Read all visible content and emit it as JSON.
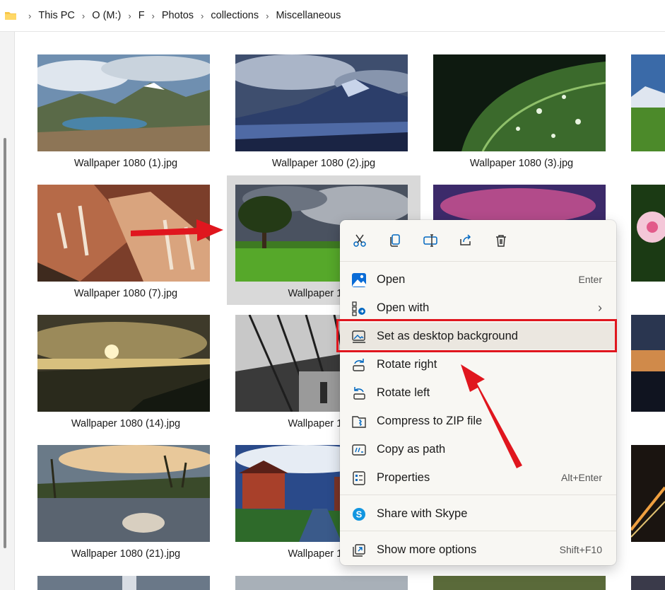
{
  "breadcrumb": {
    "items": [
      "This PC",
      "O (M:)",
      "F",
      "Photos",
      "collections",
      "Miscellaneous"
    ]
  },
  "files": [
    {
      "name": "Wallpaper 1080 (1).jpg",
      "scene": "mountain-lake"
    },
    {
      "name": "Wallpaper 1080 (2).jpg",
      "scene": "snow-mountain"
    },
    {
      "name": "Wallpaper 1080 (3).jpg",
      "scene": "leaf-drops"
    },
    {
      "name": "Wallpaper 1080 (7).jpg",
      "scene": "canyon"
    },
    {
      "name": "Wallpaper 1080",
      "scene": "tree-field"
    },
    {
      "name": "",
      "scene": "purple-sky"
    },
    {
      "name": "Wallpaper 1080 (14).jpg",
      "scene": "sunset"
    },
    {
      "name": "Wallpaper 1080",
      "scene": "hall-bw"
    },
    {
      "name": "Wallpaper 1080 (21).jpg",
      "scene": "river-rock"
    },
    {
      "name": "Wallpaper 1080",
      "scene": "red-house"
    }
  ],
  "context_menu": {
    "toolbar": [
      "cut-icon",
      "copy-icon",
      "rename-icon",
      "share-icon",
      "delete-icon"
    ],
    "items": [
      {
        "label": "Open",
        "accel": "Enter",
        "icon": "photos-icon"
      },
      {
        "label": "Open with",
        "accel": "›",
        "icon": "open-with-icon"
      },
      {
        "label": "Set as desktop background",
        "accel": "",
        "icon": "desktop-background-icon"
      },
      {
        "label": "Rotate right",
        "accel": "",
        "icon": "rotate-right-icon"
      },
      {
        "label": "Rotate left",
        "accel": "",
        "icon": "rotate-left-icon"
      },
      {
        "label": "Compress to ZIP file",
        "accel": "",
        "icon": "zip-icon"
      },
      {
        "label": "Copy as path",
        "accel": "",
        "icon": "copy-path-icon"
      },
      {
        "label": "Properties",
        "accel": "Alt+Enter",
        "icon": "properties-icon"
      },
      {
        "label": "Share with Skype",
        "accel": "",
        "icon": "skype-icon"
      },
      {
        "label": "Show more options",
        "accel": "Shift+F10",
        "icon": "more-options-icon"
      }
    ]
  },
  "colors": {
    "highlight_box": "#e0161e",
    "accent": "#0067c0"
  }
}
